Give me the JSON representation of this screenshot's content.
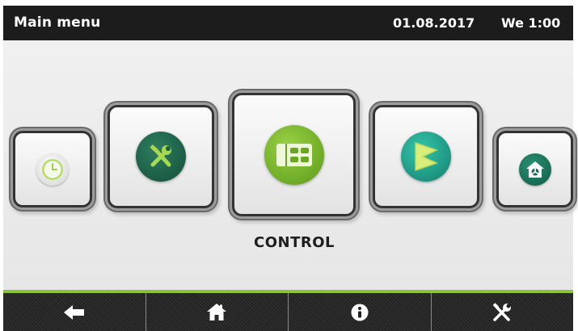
{
  "header": {
    "title": "Main menu",
    "date": "01.08.2017",
    "time": "We 1:00"
  },
  "menu": {
    "selected_label": "CONTROL",
    "items": [
      {
        "icon": "clock-icon"
      },
      {
        "icon": "wrench-screwdriver-icon"
      },
      {
        "icon": "control-panel-icon"
      },
      {
        "icon": "flow-icon"
      },
      {
        "icon": "house-fan-icon"
      }
    ]
  },
  "bottom_bar": {
    "buttons": [
      {
        "icon": "back-arrow-icon"
      },
      {
        "icon": "home-icon"
      },
      {
        "icon": "info-icon"
      },
      {
        "icon": "tools-icon"
      }
    ]
  },
  "colors": {
    "header_bg": "#1c1c1c",
    "accent_green": "#8cc43a",
    "control_green": "#7cb82f",
    "service_dark_green": "#1e6b4f",
    "flow_teal": "#22a58f"
  }
}
